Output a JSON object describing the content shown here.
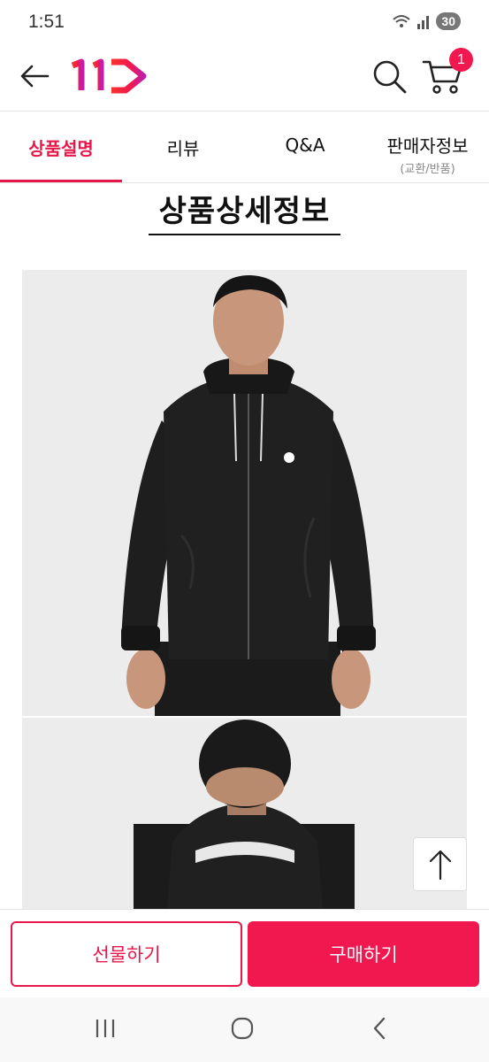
{
  "status_bar": {
    "time": "1:51",
    "battery": "30",
    "icons": [
      "wifi-icon",
      "signal-icon",
      "battery-icon"
    ]
  },
  "header": {
    "logo_text": "11",
    "logo_color": "#f0184f",
    "cart_count": "1",
    "icons": [
      "back-arrow-icon",
      "search-icon",
      "cart-icon"
    ]
  },
  "tabs": [
    {
      "label": "상품설명",
      "sub": "",
      "active": true
    },
    {
      "label": "리뷰",
      "sub": "",
      "active": false
    },
    {
      "label": "Q&A",
      "sub": "",
      "active": false
    },
    {
      "label": "판매자정보",
      "sub": "(교환/반품)",
      "active": false
    }
  ],
  "content": {
    "section_title": "상품상세정보",
    "images": [
      "jacket-front-photo",
      "jacket-back-photo"
    ]
  },
  "actions": {
    "gift_label": "선물하기",
    "buy_label": "구매하기"
  },
  "colors": {
    "accent": "#e8174a",
    "buy_bg": "#f0184f"
  },
  "system_nav": [
    "recent-apps-icon",
    "home-icon",
    "back-icon"
  ]
}
